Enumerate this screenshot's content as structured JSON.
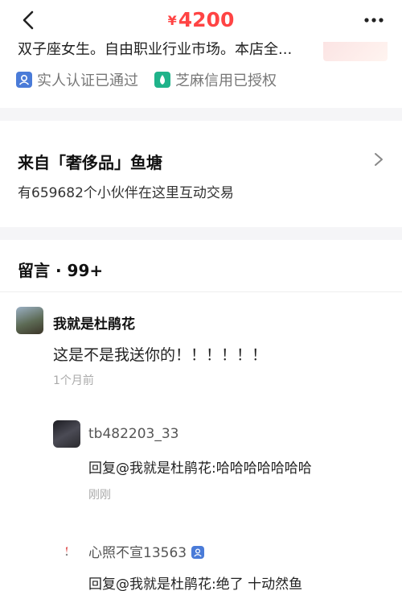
{
  "header": {
    "currency": "¥",
    "price": "4200",
    "back_icon": "chevron-left-icon",
    "more_icon": "more-dots-icon"
  },
  "seller": {
    "bio": "双子座女生。自由职业行业市场。本店全...",
    "badges": [
      {
        "label": "实人认证已通过",
        "icon": "person-verified-icon",
        "color": "#4a7bd8"
      },
      {
        "label": "芝麻信用已授权",
        "icon": "sesame-credit-icon",
        "color": "#1fb38a"
      }
    ]
  },
  "pond": {
    "title": "来自「奢侈品」鱼塘",
    "subtitle": "有659682个小伙伴在这里互动交易"
  },
  "comments": {
    "header": "留言 · 99+",
    "items": [
      {
        "user": "我就是杜鹃花",
        "text": "这是不是我送你的！！！！！！",
        "time": "1个月前"
      }
    ],
    "replies": [
      {
        "user": "tb482203_33",
        "text": "回复@我就是杜鹃花:哈哈哈哈哈哈哈",
        "time": "刚刚"
      },
      {
        "user": "心照不宣13563",
        "text": "回复@我就是杜鹃花:绝了  十动然鱼",
        "verified": true
      }
    ]
  },
  "colors": {
    "price": "#ff4444",
    "separator": "#f5f5f7",
    "muted": "#aaaaaa"
  }
}
